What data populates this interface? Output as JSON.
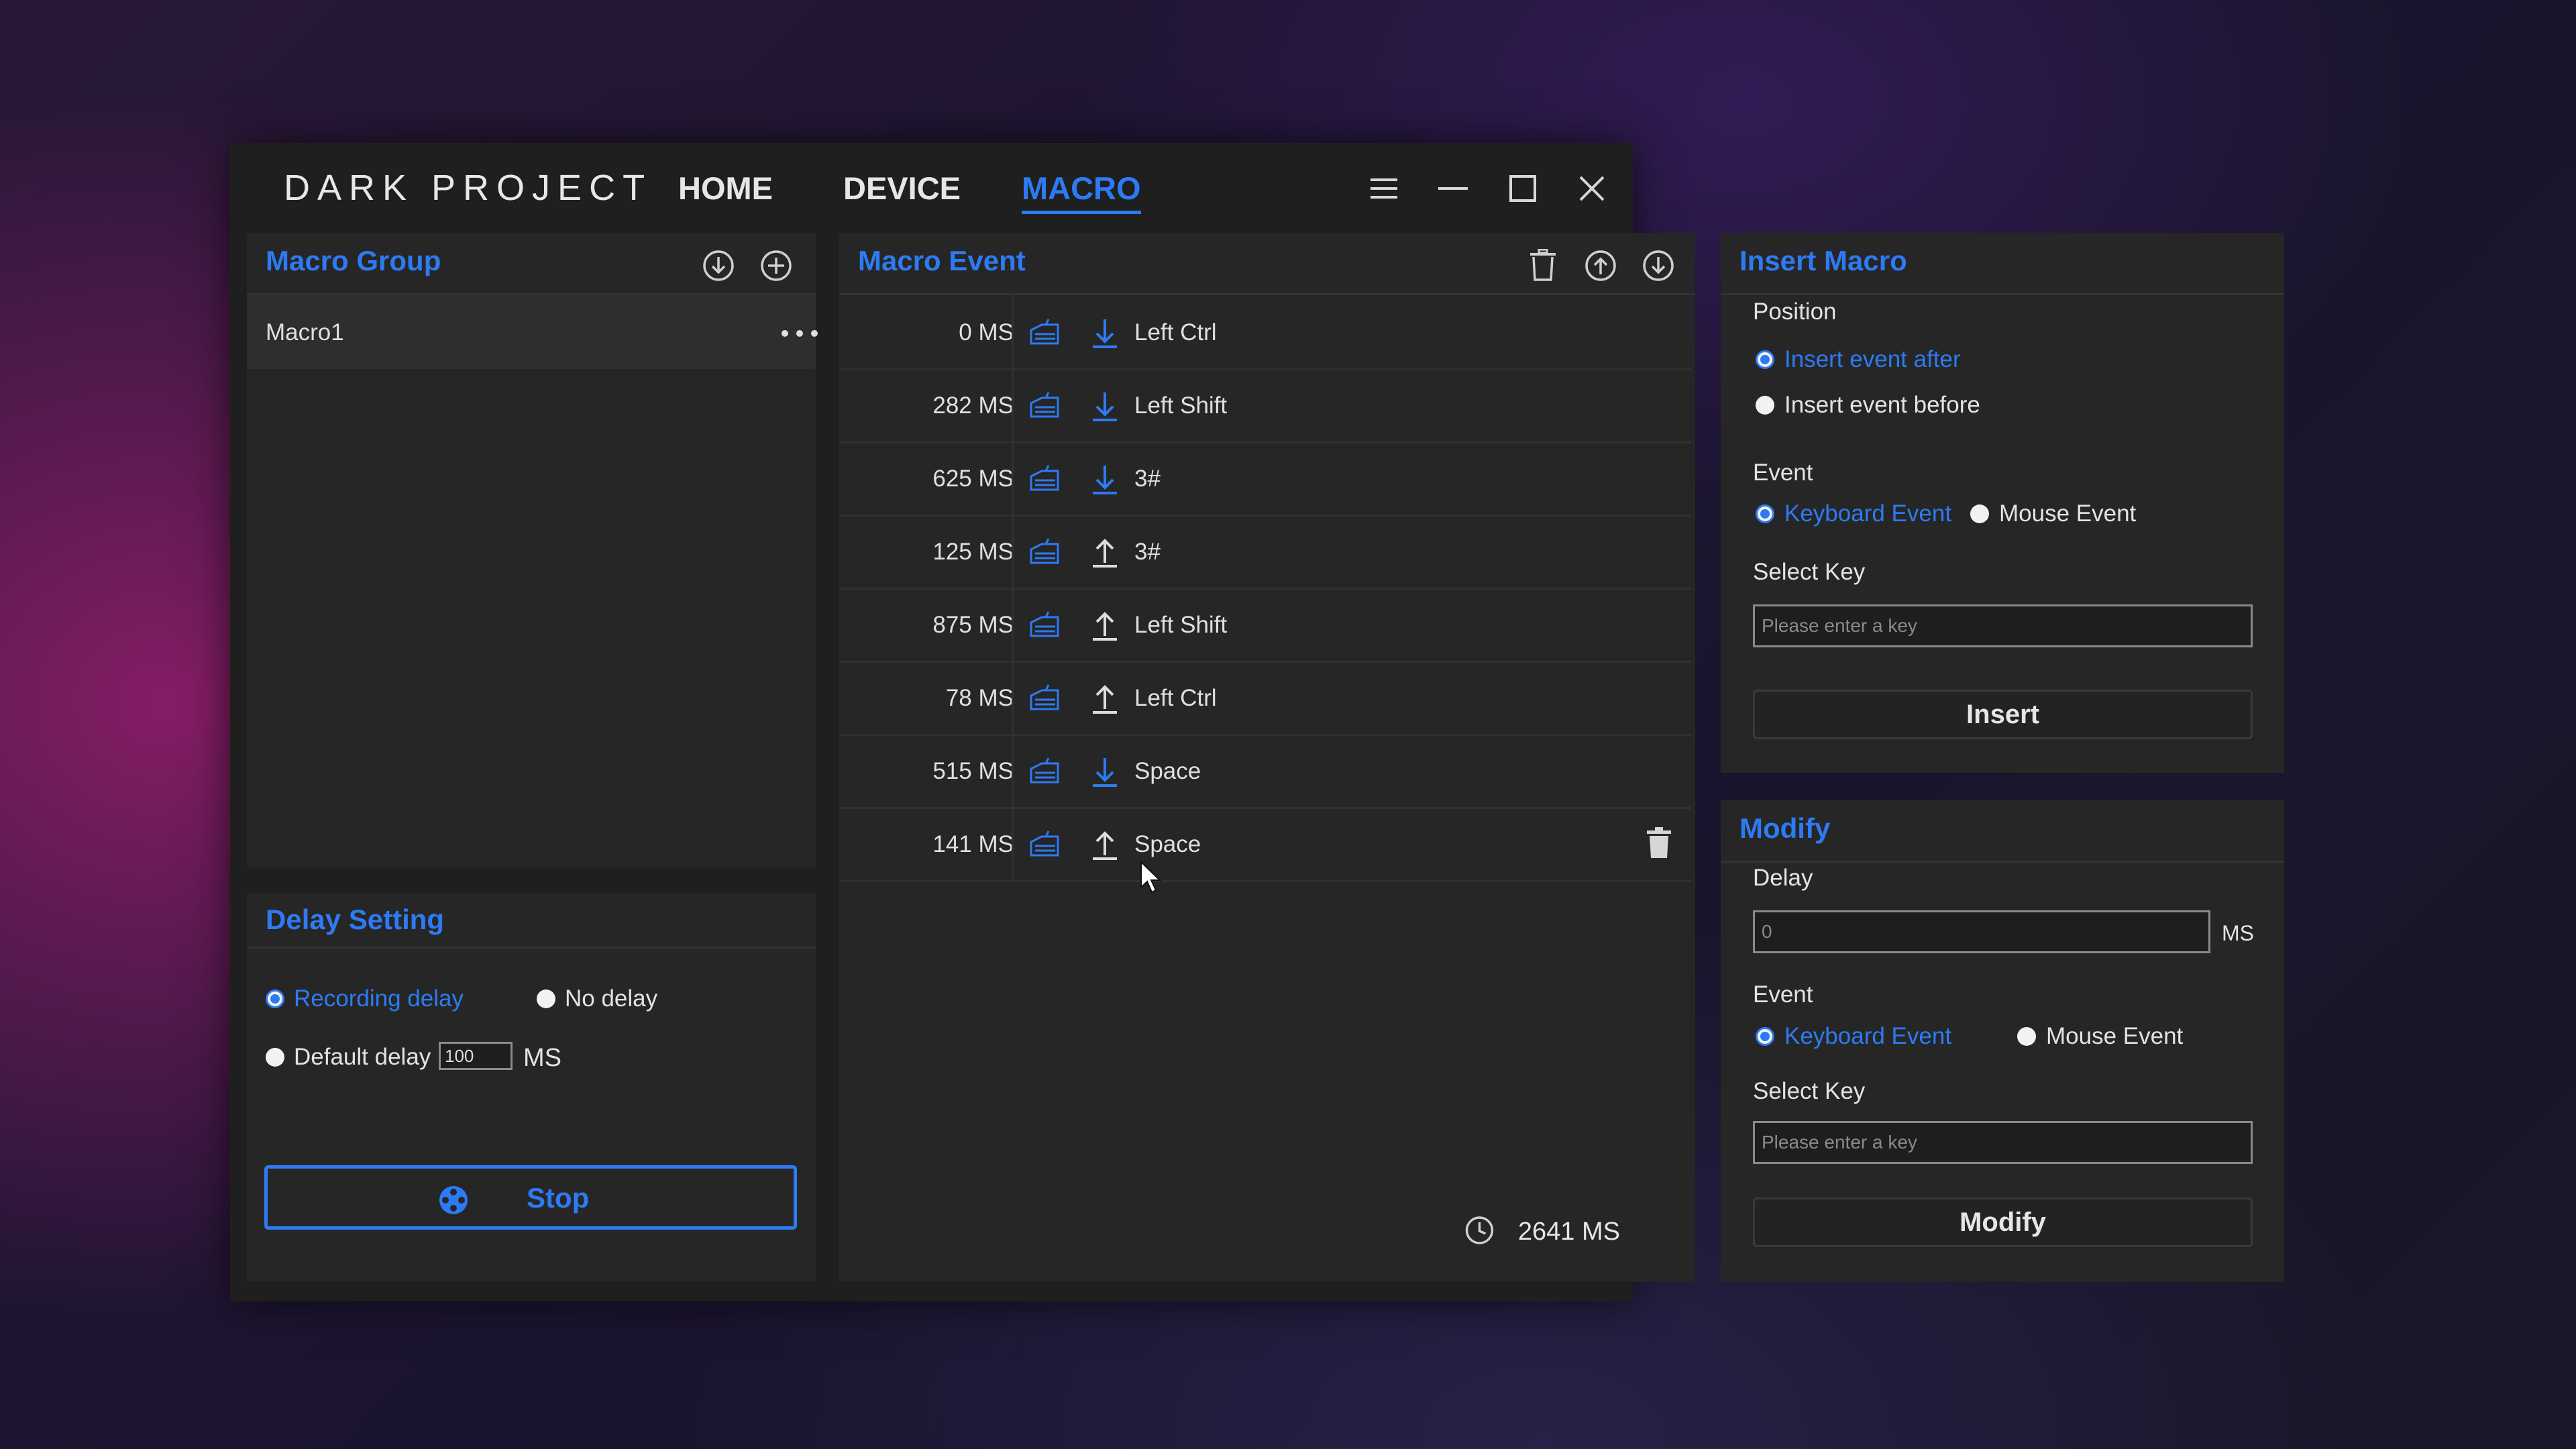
{
  "app": {
    "brand": "DARK PROJECT",
    "nav": [
      {
        "label": "HOME",
        "active": false
      },
      {
        "label": "DEVICE",
        "active": false
      },
      {
        "label": "MACRO",
        "active": true
      }
    ]
  },
  "colors": {
    "accent": "#2d7bf4",
    "panel": "#262626",
    "window": "#1f1f1f"
  },
  "macro_group": {
    "title": "Macro Group",
    "items": [
      {
        "name": "Macro1"
      }
    ]
  },
  "delay_setting": {
    "title": "Delay Setting",
    "recording_delay": "Recording delay",
    "no_delay": "No delay",
    "default_delay": "Default delay",
    "default_delay_value": "100",
    "unit": "MS",
    "selected": "recording_delay",
    "stop_label": "Stop"
  },
  "macro_event": {
    "title": "Macro Event",
    "events": [
      {
        "delay": "0 MS",
        "direction": "down",
        "key": "Left Ctrl"
      },
      {
        "delay": "282 MS",
        "direction": "down",
        "key": "Left Shift"
      },
      {
        "delay": "625 MS",
        "direction": "down",
        "key": "3#"
      },
      {
        "delay": "125 MS",
        "direction": "up",
        "key": "3#"
      },
      {
        "delay": "875 MS",
        "direction": "up",
        "key": "Left Shift"
      },
      {
        "delay": "78 MS",
        "direction": "up",
        "key": "Left Ctrl"
      },
      {
        "delay": "515 MS",
        "direction": "down",
        "key": "Space"
      },
      {
        "delay": "141 MS",
        "direction": "up",
        "key": "Space"
      }
    ],
    "total": "2641 MS"
  },
  "insert_macro": {
    "title": "Insert Macro",
    "position_label": "Position",
    "insert_after": "Insert event after",
    "insert_before": "Insert event before",
    "event_label": "Event",
    "keyboard_event": "Keyboard Event",
    "mouse_event": "Mouse Event",
    "select_key_label": "Select Key",
    "key_placeholder": "Please enter a key",
    "insert_button": "Insert"
  },
  "modify": {
    "title": "Modify",
    "delay_label": "Delay",
    "delay_value": "0",
    "unit": "MS",
    "event_label": "Event",
    "keyboard_event": "Keyboard Event",
    "mouse_event": "Mouse Event",
    "select_key_label": "Select Key",
    "key_placeholder": "Please enter a key",
    "modify_button": "Modify"
  }
}
